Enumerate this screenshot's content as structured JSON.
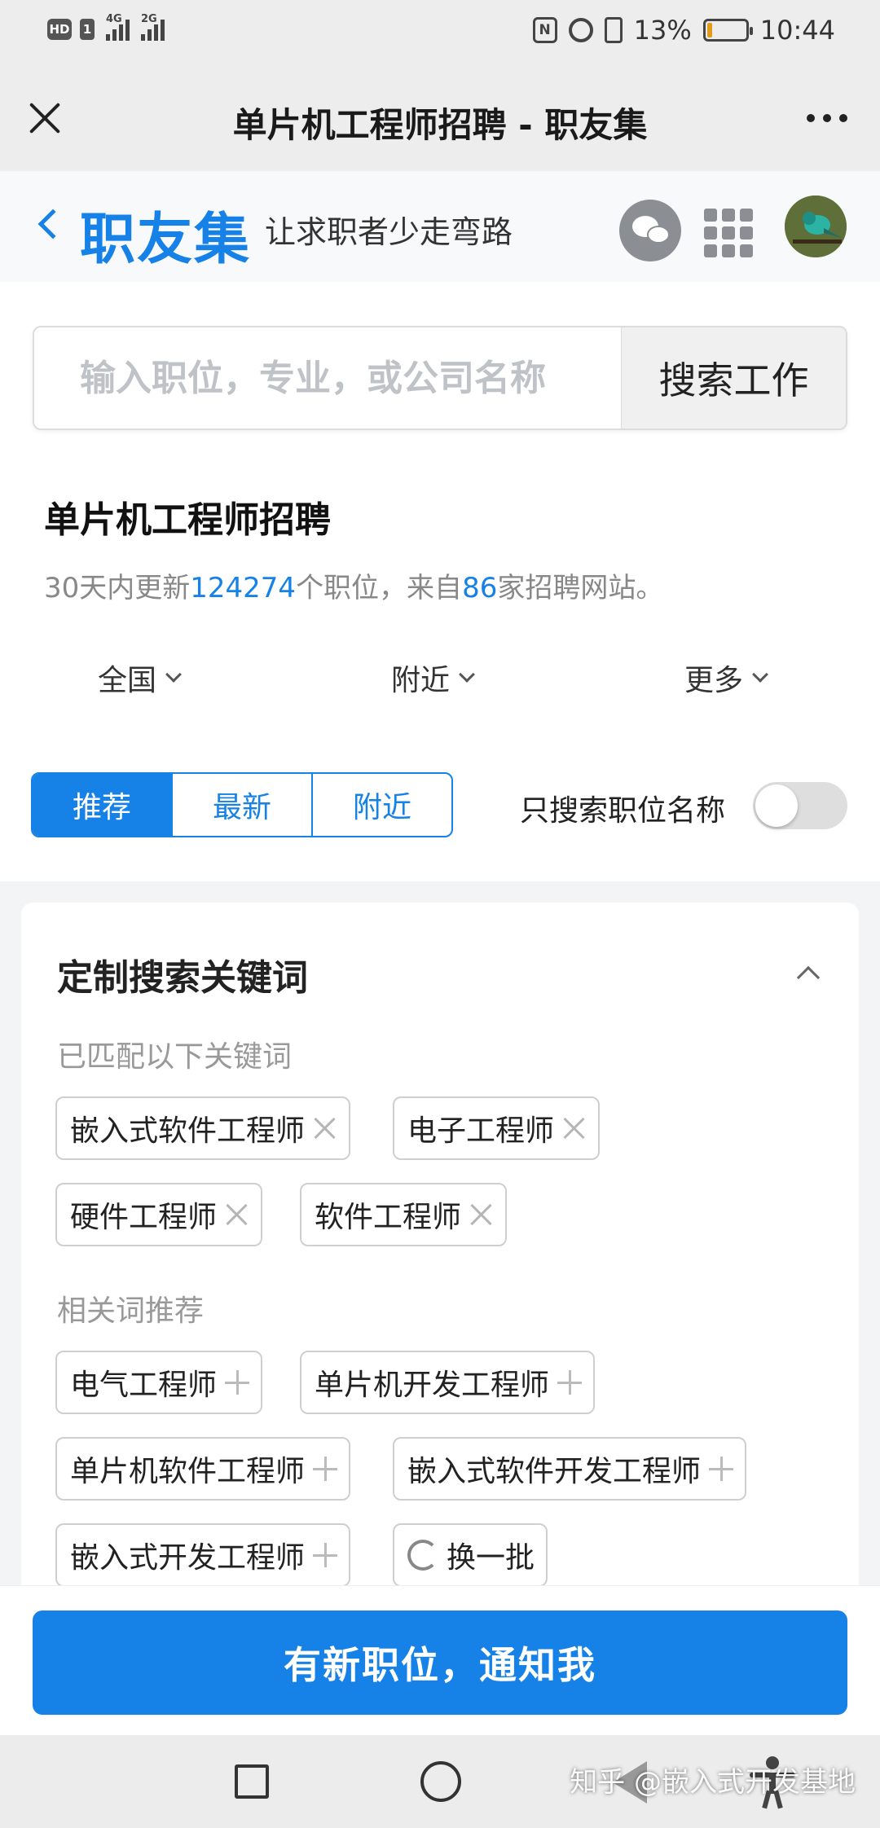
{
  "status_bar": {
    "hd_badge": "HD",
    "sim_badge": "1",
    "network_1": "4G",
    "network_2": "2G",
    "nfc": "N",
    "battery_percent": "13%",
    "battery_level": 0.13,
    "time": "10:44"
  },
  "titlebar": {
    "title": "单片机工程师招聘 - 职友集"
  },
  "site_header": {
    "logo": "职友集",
    "slogan": "让求职者少走弯路"
  },
  "search": {
    "placeholder": "输入职位，专业，或公司名称",
    "button_label": "搜索工作"
  },
  "page": {
    "title": "单片机工程师招聘",
    "stats_prefix": "30天内更新",
    "stats_jobs": "124274",
    "stats_middle": "个职位，来自",
    "stats_sites": "86",
    "stats_suffix": "家招聘网站。"
  },
  "filters": {
    "region": "全国",
    "nearby": "附近",
    "more": "更多"
  },
  "sort_tabs": {
    "recommend": "推荐",
    "latest": "最新",
    "nearby": "附近"
  },
  "toggle": {
    "label": "只搜索职位名称",
    "on": false
  },
  "keywords": {
    "title": "定制搜索关键词",
    "matched_label": "已匹配以下关键词",
    "matched": [
      "嵌入式软件工程师",
      "电子工程师",
      "硬件工程师",
      "软件工程师"
    ],
    "related_label": "相关词推荐",
    "related": [
      "电气工程师",
      "单片机开发工程师",
      "单片机软件工程师",
      "嵌入式软件开发工程师",
      "嵌入式开发工程师"
    ],
    "refresh_label": "换一批"
  },
  "notify": {
    "button_label": "有新职位，通知我"
  },
  "watermark": "知乎 @嵌入式开发基地",
  "colors": {
    "accent": "#1681e6",
    "toolbar_bg": "#ededed"
  }
}
